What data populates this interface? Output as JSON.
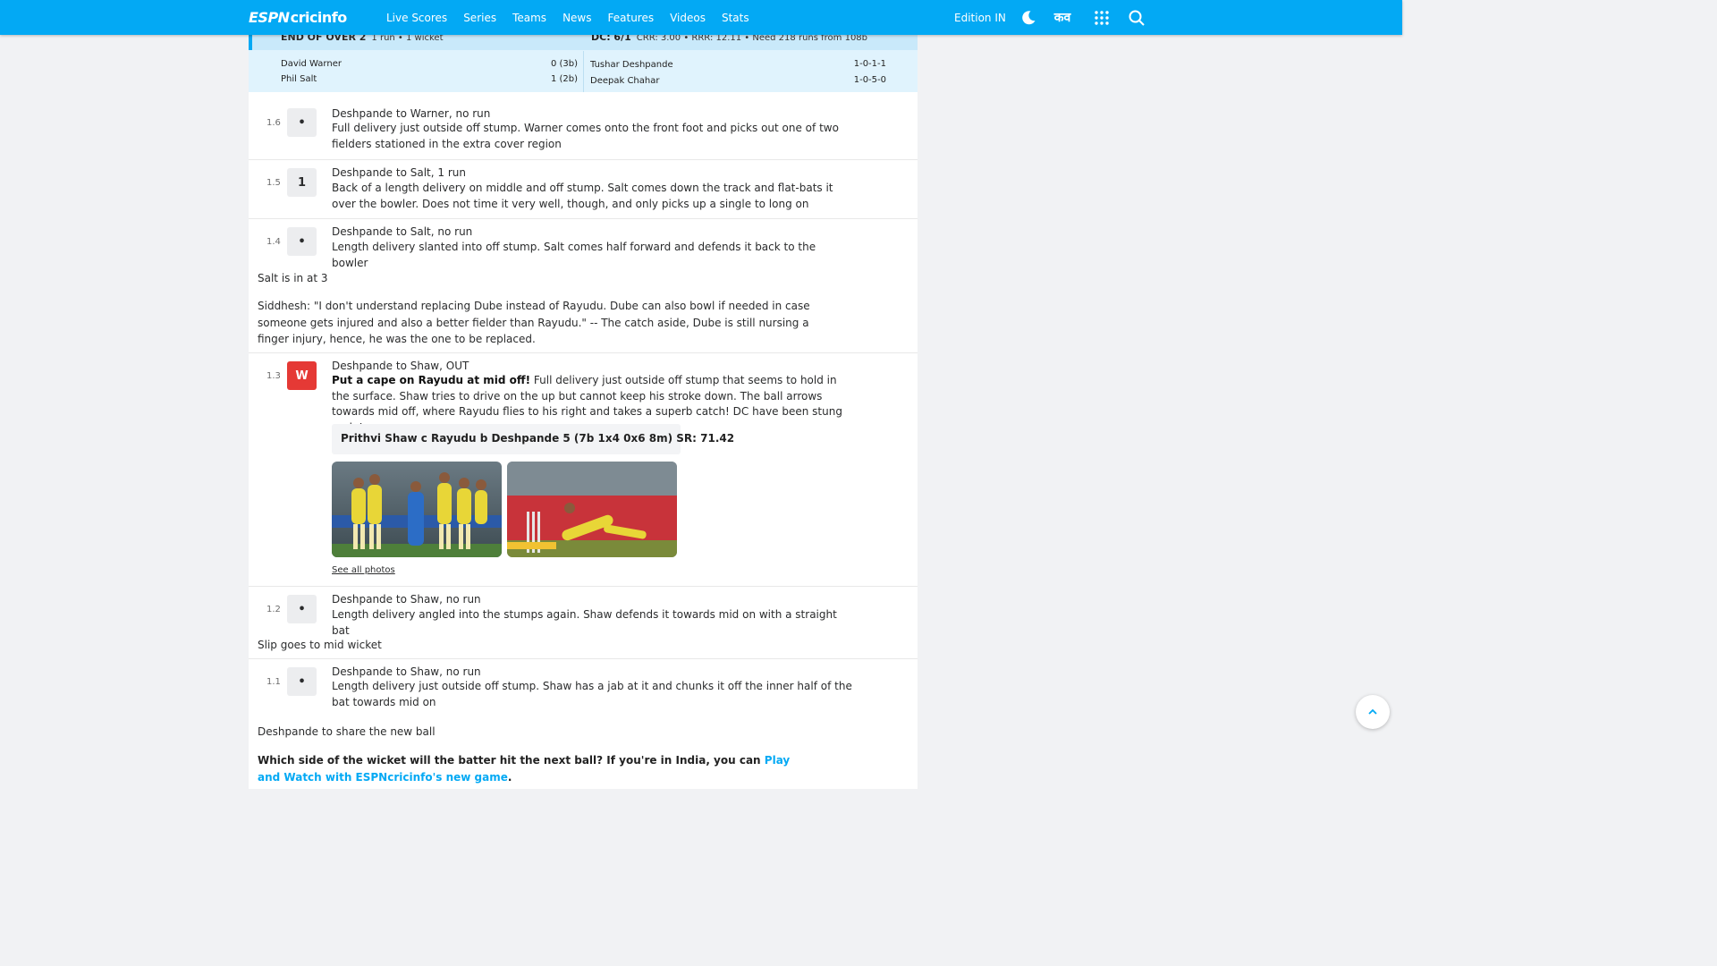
{
  "nav": {
    "logo_espn": "ESPN",
    "logo_cricinfo": "cricinfo",
    "links": [
      "Live Scores",
      "Series",
      "Teams",
      "News",
      "Features",
      "Videos",
      "Stats"
    ],
    "edition": "Edition IN",
    "hindi_label": "कव",
    "icons": [
      "moon-icon",
      "apps-grid-icon",
      "search-icon"
    ],
    "accent_color": "#03a9f4"
  },
  "over_summary": {
    "title": "END OF OVER 2",
    "over_detail": "1 run • 1 wicket",
    "team_score": "DC: 6/1",
    "rates": "CRR: 3.00 • RRR: 12.11 • Need 218 runs from 108b",
    "batters": [
      {
        "name": "David Warner",
        "score": "0 (3b)"
      },
      {
        "name": "Phil Salt",
        "score": "1 (2b)"
      }
    ],
    "bowlers": [
      {
        "name": "Tushar Deshpande",
        "figures": "1-0-1-1"
      },
      {
        "name": "Deepak Chahar",
        "figures": "1-0-5-0"
      }
    ]
  },
  "commentary": {
    "b16": {
      "over": "1.6",
      "result": "•",
      "title": "Deshpande to Warner, no run",
      "text": "Full delivery just outside off stump. Warner comes onto the front foot and picks out one of two fielders stationed in the extra cover region"
    },
    "b15": {
      "over": "1.5",
      "result": "1",
      "title": "Deshpande to Salt, 1 run",
      "text": "Back of a length delivery on middle and off stump. Salt comes down the track and flat-bats it over the bowler. Does not time it very well, though, and only picks up a single to long on"
    },
    "b14": {
      "over": "1.4",
      "result": "•",
      "title": "Deshpande to Salt, no run",
      "text": "Length delivery slanted into off stump. Salt comes half forward and defends it back to the bowler",
      "note1": "Salt is in at 3",
      "note2": "Siddhesh: \"I don't understand replacing Dube instead of Rayudu. Dube can also bowl if needed in case someone gets injured and also a better fielder than Rayudu.\" -- The catch aside, Dube is still nursing a finger injury, hence, he was the one to be replaced."
    },
    "b13": {
      "over": "1.3",
      "result": "W",
      "title": "Deshpande to Shaw, OUT",
      "headline": "Put a cape on Rayudu at mid off!",
      "text": "Full delivery just outside off stump that seems to hold in the surface. Shaw tries to drive on the up but cannot keep his stroke down. The ball arrows towards mid off, where Rayudu flies to his right and takes a superb catch! DC have been stung early!",
      "dismissal": "Prithvi Shaw c Rayudu b Deshpande 5 (7b 1x4 0x6 8m) SR: 71.42",
      "see_all": "See all photos"
    },
    "b12": {
      "over": "1.2",
      "result": "•",
      "title": "Deshpande to Shaw, no run",
      "text": "Length delivery angled into the stumps again. Shaw defends it towards mid on with a straight bat",
      "note": "Slip goes to mid wicket"
    },
    "b11": {
      "over": "1.1",
      "result": "•",
      "title": "Deshpande to Shaw, no run",
      "text": "Length delivery just outside off stump. Shaw has a jab at it and chunks it off the inner half of the bat towards mid on",
      "note": "Deshpande to share the new ball"
    },
    "promo": {
      "question": "Which side of the wicket will the batter hit the next ball? If you're in India, you can ",
      "link": "Play and Watch with ESPNcricinfo's new game",
      "end": "."
    }
  },
  "colors": {
    "wicket": "#e53935",
    "summary_bg": "#e0f3fd",
    "link": "#03a9f4"
  }
}
